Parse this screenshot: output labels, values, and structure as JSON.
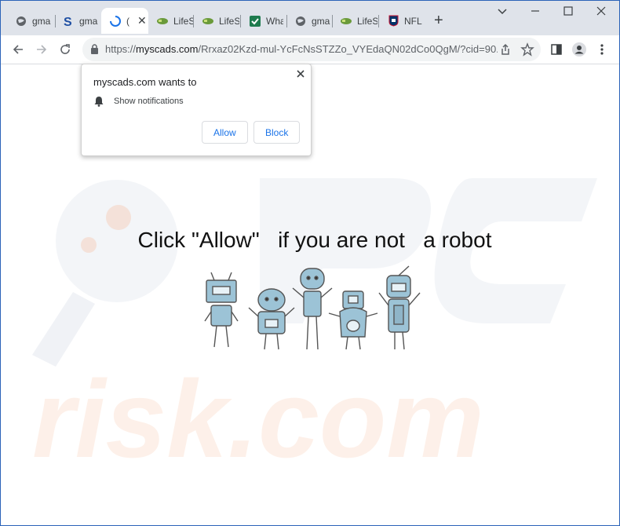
{
  "tabs": [
    {
      "title": "gma",
      "icon": "globe-icon"
    },
    {
      "title": "gma",
      "icon": "s-logo-icon"
    },
    {
      "title": "(",
      "icon": "loading-icon",
      "active": true
    },
    {
      "title": "LifeS",
      "icon": "lifes-logo-icon"
    },
    {
      "title": "LifeS",
      "icon": "lifes-logo-icon"
    },
    {
      "title": "Wha",
      "icon": "check-icon"
    },
    {
      "title": "gma",
      "icon": "globe-icon"
    },
    {
      "title": "LifeS",
      "icon": "lifes-logo-icon"
    },
    {
      "title": "NFL",
      "icon": "nfl-shield-icon"
    }
  ],
  "address": {
    "scheme": "https://",
    "host": "myscads.com",
    "path": "/Rrxaz02Kzd-mul-YcFcNsSTZZo_VYEdaQN02dCo0QgM/?cid=90..."
  },
  "popup": {
    "site_text": "myscads.com wants to",
    "permission": "Show notifications",
    "allow_label": "Allow",
    "block_label": "Block"
  },
  "page": {
    "headline": "Click \"Allow\"   if you are not   a robot"
  },
  "watermark": {
    "text": "risk.com",
    "color": "#f6a97a"
  },
  "colors": {
    "accent": "#1a73e8",
    "robot": "#9cc3d6"
  }
}
